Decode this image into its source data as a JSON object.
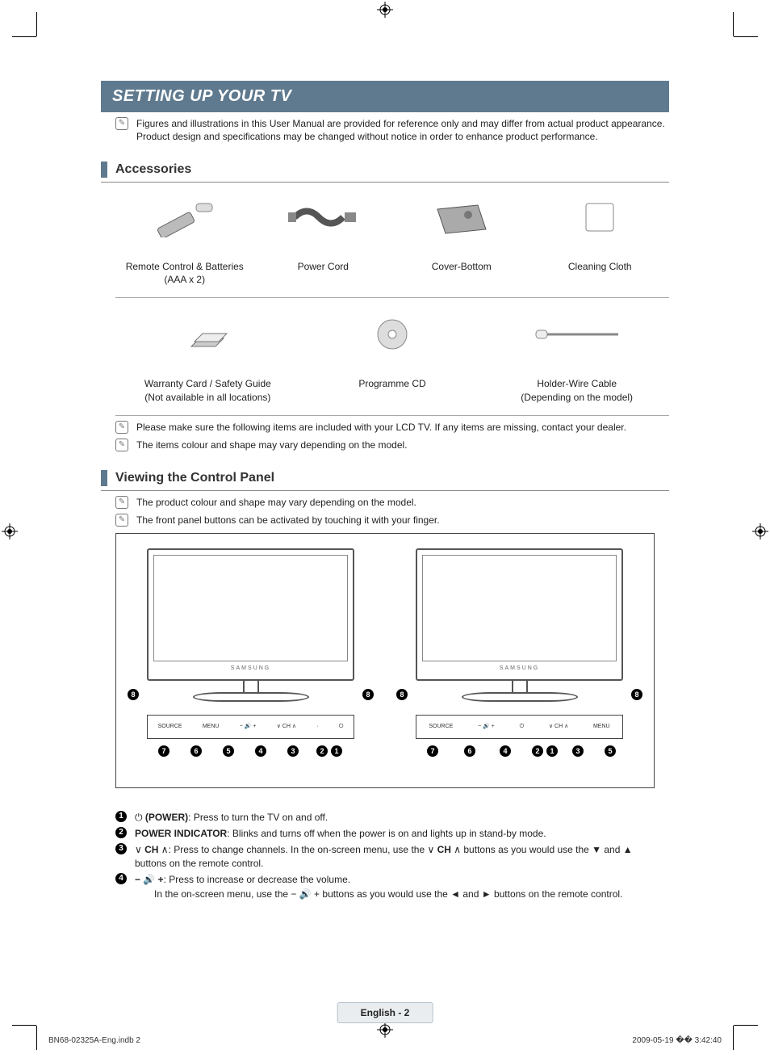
{
  "header": {
    "title": "SETTING UP YOUR TV",
    "intro_note": "Figures and illustrations in this User Manual are provided for reference only and may differ from actual product appearance. Product design and specifications may be changed without notice in order to enhance product performance."
  },
  "accessories": {
    "heading": "Accessories",
    "row1": [
      "Remote Control & Batteries (AAA x 2)",
      "Power Cord",
      "Cover-Bottom",
      "Cleaning Cloth"
    ],
    "row2_a": "Warranty Card / Safety Guide",
    "row2_a_sub": "(Not available in all locations)",
    "row2_b": "Programme CD",
    "row2_c": "Holder-Wire Cable",
    "row2_c_sub": "(Depending on the model)",
    "note1": "Please make sure the following items are included with your LCD TV. If any items are missing, contact your dealer.",
    "note2": "The items colour and shape may vary depending on the model."
  },
  "control_panel": {
    "heading": "Viewing the Control Panel",
    "note1": "The product colour and shape may vary depending on the model.",
    "note2": "The front panel buttons can be activated by touching it with your finger.",
    "brand": "SAMSUNG",
    "btns_left": [
      "SOURCE",
      "MENU",
      "− 🔊 +",
      "∨ CH ∧",
      "·",
      "⏻"
    ],
    "btns_right": [
      "SOURCE",
      "− 🔊 +",
      "⏻",
      "∨ CH ∧",
      "MENU"
    ]
  },
  "legend": {
    "l1_label": "(POWER)",
    "l1_text": ": Press to turn the TV on and off.",
    "l2_label": "POWER INDICATOR",
    "l2_text": ": Blinks and turns off when the power is on and lights up in stand-by mode.",
    "l3_pre": "",
    "l3_label": "CH",
    "l3_text": ": Press to change channels. In the on-screen menu, use the ",
    "l3_mid": " buttons as you would use the ▼ and ▲ buttons on the remote control.",
    "l4_label": "",
    "l4_text": ": Press to increase or decrease the volume.",
    "l4_sub": "In the on-screen menu, use the − 🔊 + buttons as you would use the ◄ and ► buttons on the remote control."
  },
  "footer": {
    "page_label": "English - 2",
    "imprint_left": "BN68-02325A-Eng.indb   2",
    "imprint_right": "2009-05-19   �� 3:42:40"
  }
}
